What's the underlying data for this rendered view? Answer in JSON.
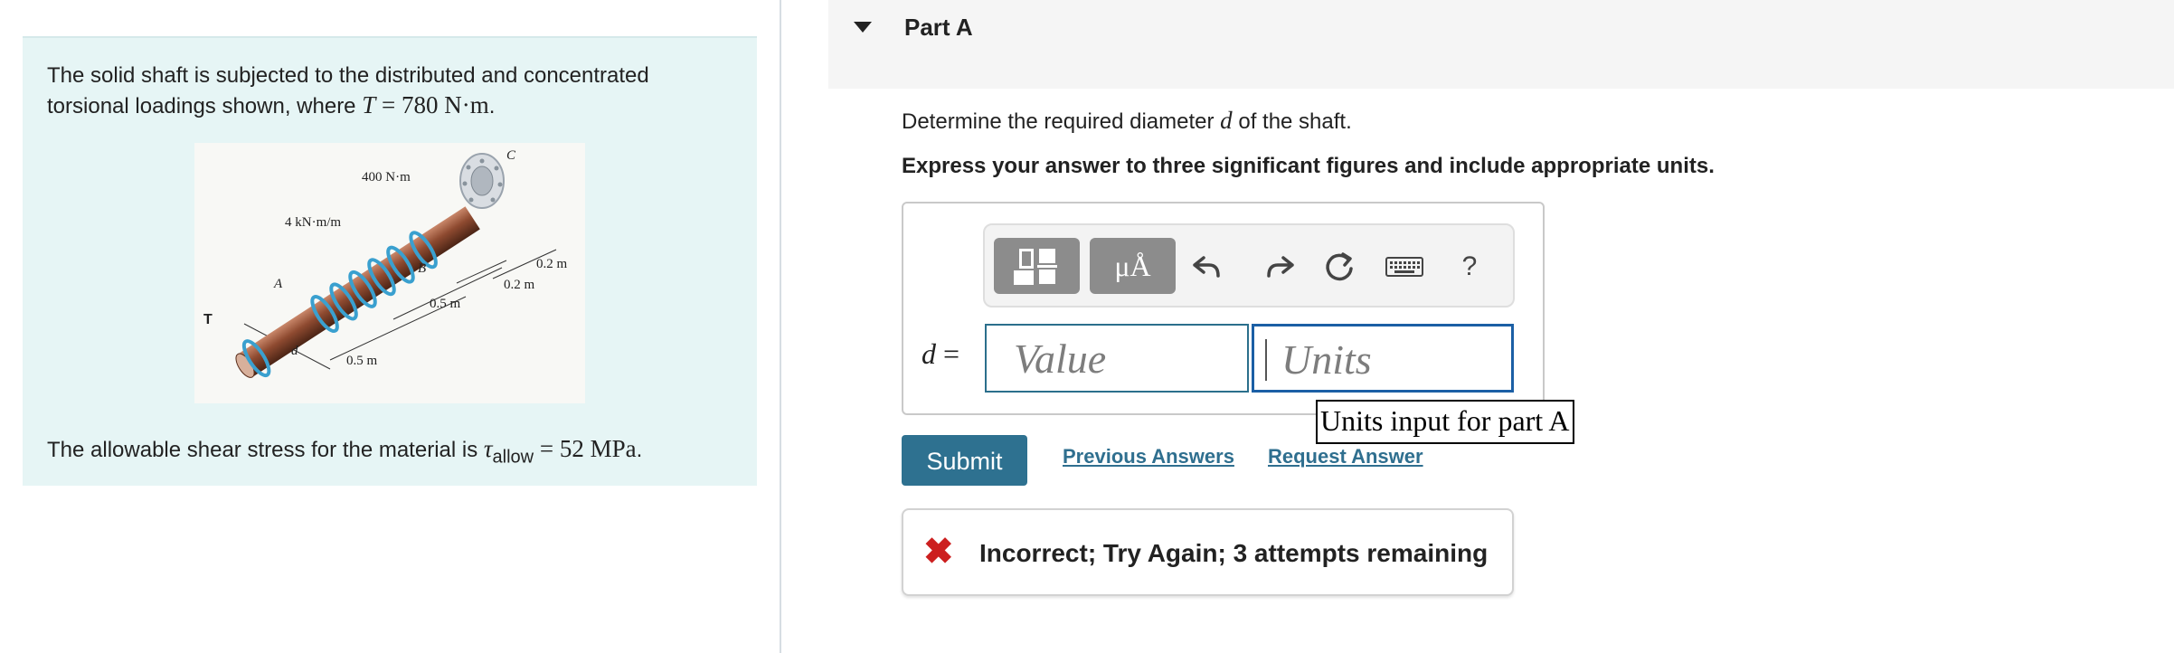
{
  "problem": {
    "intro": "The solid shaft is subjected to the distributed and concentrated torsional loadings shown, where",
    "T_symbol": "T",
    "T_equals": " = ",
    "T_value": "780 N·m",
    "T_period": ".",
    "shear_prefix": "The allowable shear stress for the material is ",
    "tau_symbol": "τ",
    "tau_subscript": "allow",
    "tau_equals": " = ",
    "tau_value": "52 MPa",
    "tau_period": "."
  },
  "figure_labels": {
    "torque_conc": "400 N·m",
    "dist_load": "4 kN·m/m",
    "point_c": "C",
    "point_a": "A",
    "point_b": "B",
    "torque_t": "T",
    "diameter_d": "d",
    "dim_02a": "0.2 m",
    "dim_02b": "0.2 m",
    "dim_05a": "0.5 m",
    "dim_05b": "0.5 m"
  },
  "part": {
    "title": "Part A",
    "question_prefix": "Determine the required diameter ",
    "question_var": "d",
    "question_suffix": " of the shaft.",
    "instruction": "Express your answer to three significant figures and include appropriate units."
  },
  "answer": {
    "label_var": "d",
    "label_eq": " =",
    "value_placeholder": "Value",
    "units_placeholder": "Units",
    "symbols_label": "μÅ",
    "help_label": "?",
    "tooltip": "Units input for part A"
  },
  "actions": {
    "submit": "Submit",
    "previous_answers": "Previous Answers",
    "request_answer": "Request Answer"
  },
  "feedback": {
    "message": "Incorrect; Try Again; 3 attempts remaining"
  },
  "icons": {
    "undo": "undo-icon",
    "redo": "redo-icon",
    "reset": "reset-icon",
    "keyboard": "keyboard-icon",
    "incorrect": "incorrect-x-icon"
  },
  "colors": {
    "panel_bg": "#e6f5f5",
    "submit_bg": "#2e7190",
    "link": "#2f6f8f",
    "error": "#cc1f1f"
  }
}
